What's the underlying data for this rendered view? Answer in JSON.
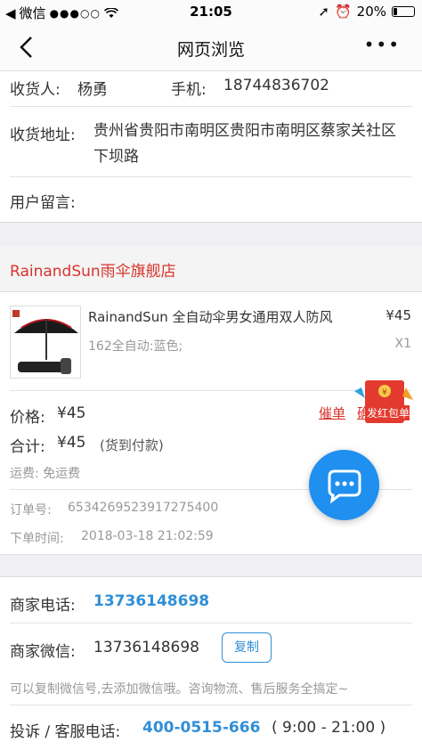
{
  "status_bar": {
    "carrier": "微信",
    "time": "21:05",
    "battery": "20%",
    "battery_level": 0.2
  },
  "navbar": {
    "title": "网页浏览"
  },
  "order": {
    "recipient_label": "收货人:",
    "recipient": "杨勇",
    "phone_label": "手机:",
    "phone": "18744836702",
    "address_label": "收货地址:",
    "address": "贵州省贵阳市南明区贵阳市南明区蔡家关社区下坝路",
    "message_label": "用户留言:"
  },
  "shop": {
    "name": "RainandSun雨伞旗舰店"
  },
  "product": {
    "title": "RainandSun 全自动伞男女通用双人防风",
    "price": "¥45",
    "spec": "162全自动:蓝色;",
    "qty": "X1"
  },
  "summary": {
    "price_label": "价格:",
    "price": "¥45",
    "total_label": "合计:",
    "total": "¥45",
    "payment_note": "(货到付款)",
    "shipping": "运费: 免运费",
    "order_no_label": "订单号:",
    "order_no": "6534269523917275400",
    "order_time_label": "下单时间:",
    "order_time": "2018-03-18 21:02:59",
    "urge_label": "催单",
    "confirm_label": "确",
    "red_packet_text": "发红包单"
  },
  "merchant": {
    "phone_label": "商家电话:",
    "phone": "13736148698",
    "wechat_label": "商家微信:",
    "wechat": "13736148698",
    "copy_label": "复制",
    "hint": "可以复制微信号,去添加微信哦。咨询物流、售后服务全搞定~",
    "complaint_label": "投诉 / 客服电话:",
    "complaint_phone": "400-0515-666",
    "complaint_hours": "( 9:00 - 21:00 )"
  },
  "colors": {
    "accent_red": "#d8342b",
    "link_blue": "#2f8fd6",
    "chat_blue": "#1f8ff0"
  }
}
